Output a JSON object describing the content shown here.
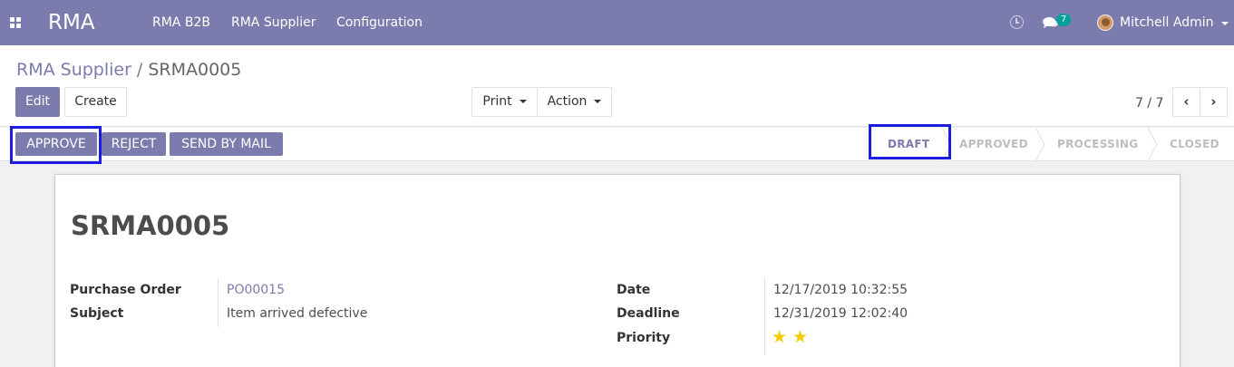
{
  "navbar": {
    "app_name": "RMA",
    "menu": [
      "RMA B2B",
      "RMA Supplier",
      "Configuration"
    ],
    "message_count": "7",
    "user_name": "Mitchell Admin"
  },
  "breadcrumb": {
    "parent": "RMA Supplier",
    "separator": "/",
    "current": "SRMA0005"
  },
  "buttons": {
    "edit": "Edit",
    "create": "Create",
    "print": "Print",
    "action": "Action"
  },
  "pager": {
    "value": "7 / 7",
    "prev": "‹",
    "next": "›"
  },
  "statusbar": {
    "buttons": [
      "APPROVE",
      "REJECT",
      "SEND BY MAIL"
    ],
    "stages": [
      "DRAFT",
      "APPROVED",
      "PROCESSING",
      "CLOSED"
    ],
    "active_stage": "DRAFT"
  },
  "record": {
    "name": "SRMA0005",
    "fields_left": [
      {
        "label": "Purchase Order",
        "value": "PO00015"
      },
      {
        "label": "Subject",
        "value": "Item arrived defective"
      }
    ],
    "fields_right": [
      {
        "label": "Date",
        "value": "12/17/2019 10:32:55"
      },
      {
        "label": "Deadline",
        "value": "12/31/2019 12:02:40"
      },
      {
        "label": "Priority",
        "value": ""
      }
    ],
    "priority_stars": 2
  },
  "colors": {
    "brand": "#7c7bad",
    "badge": "#00a09d",
    "star": "#f3cc00",
    "highlight": "#1c1ce0"
  }
}
